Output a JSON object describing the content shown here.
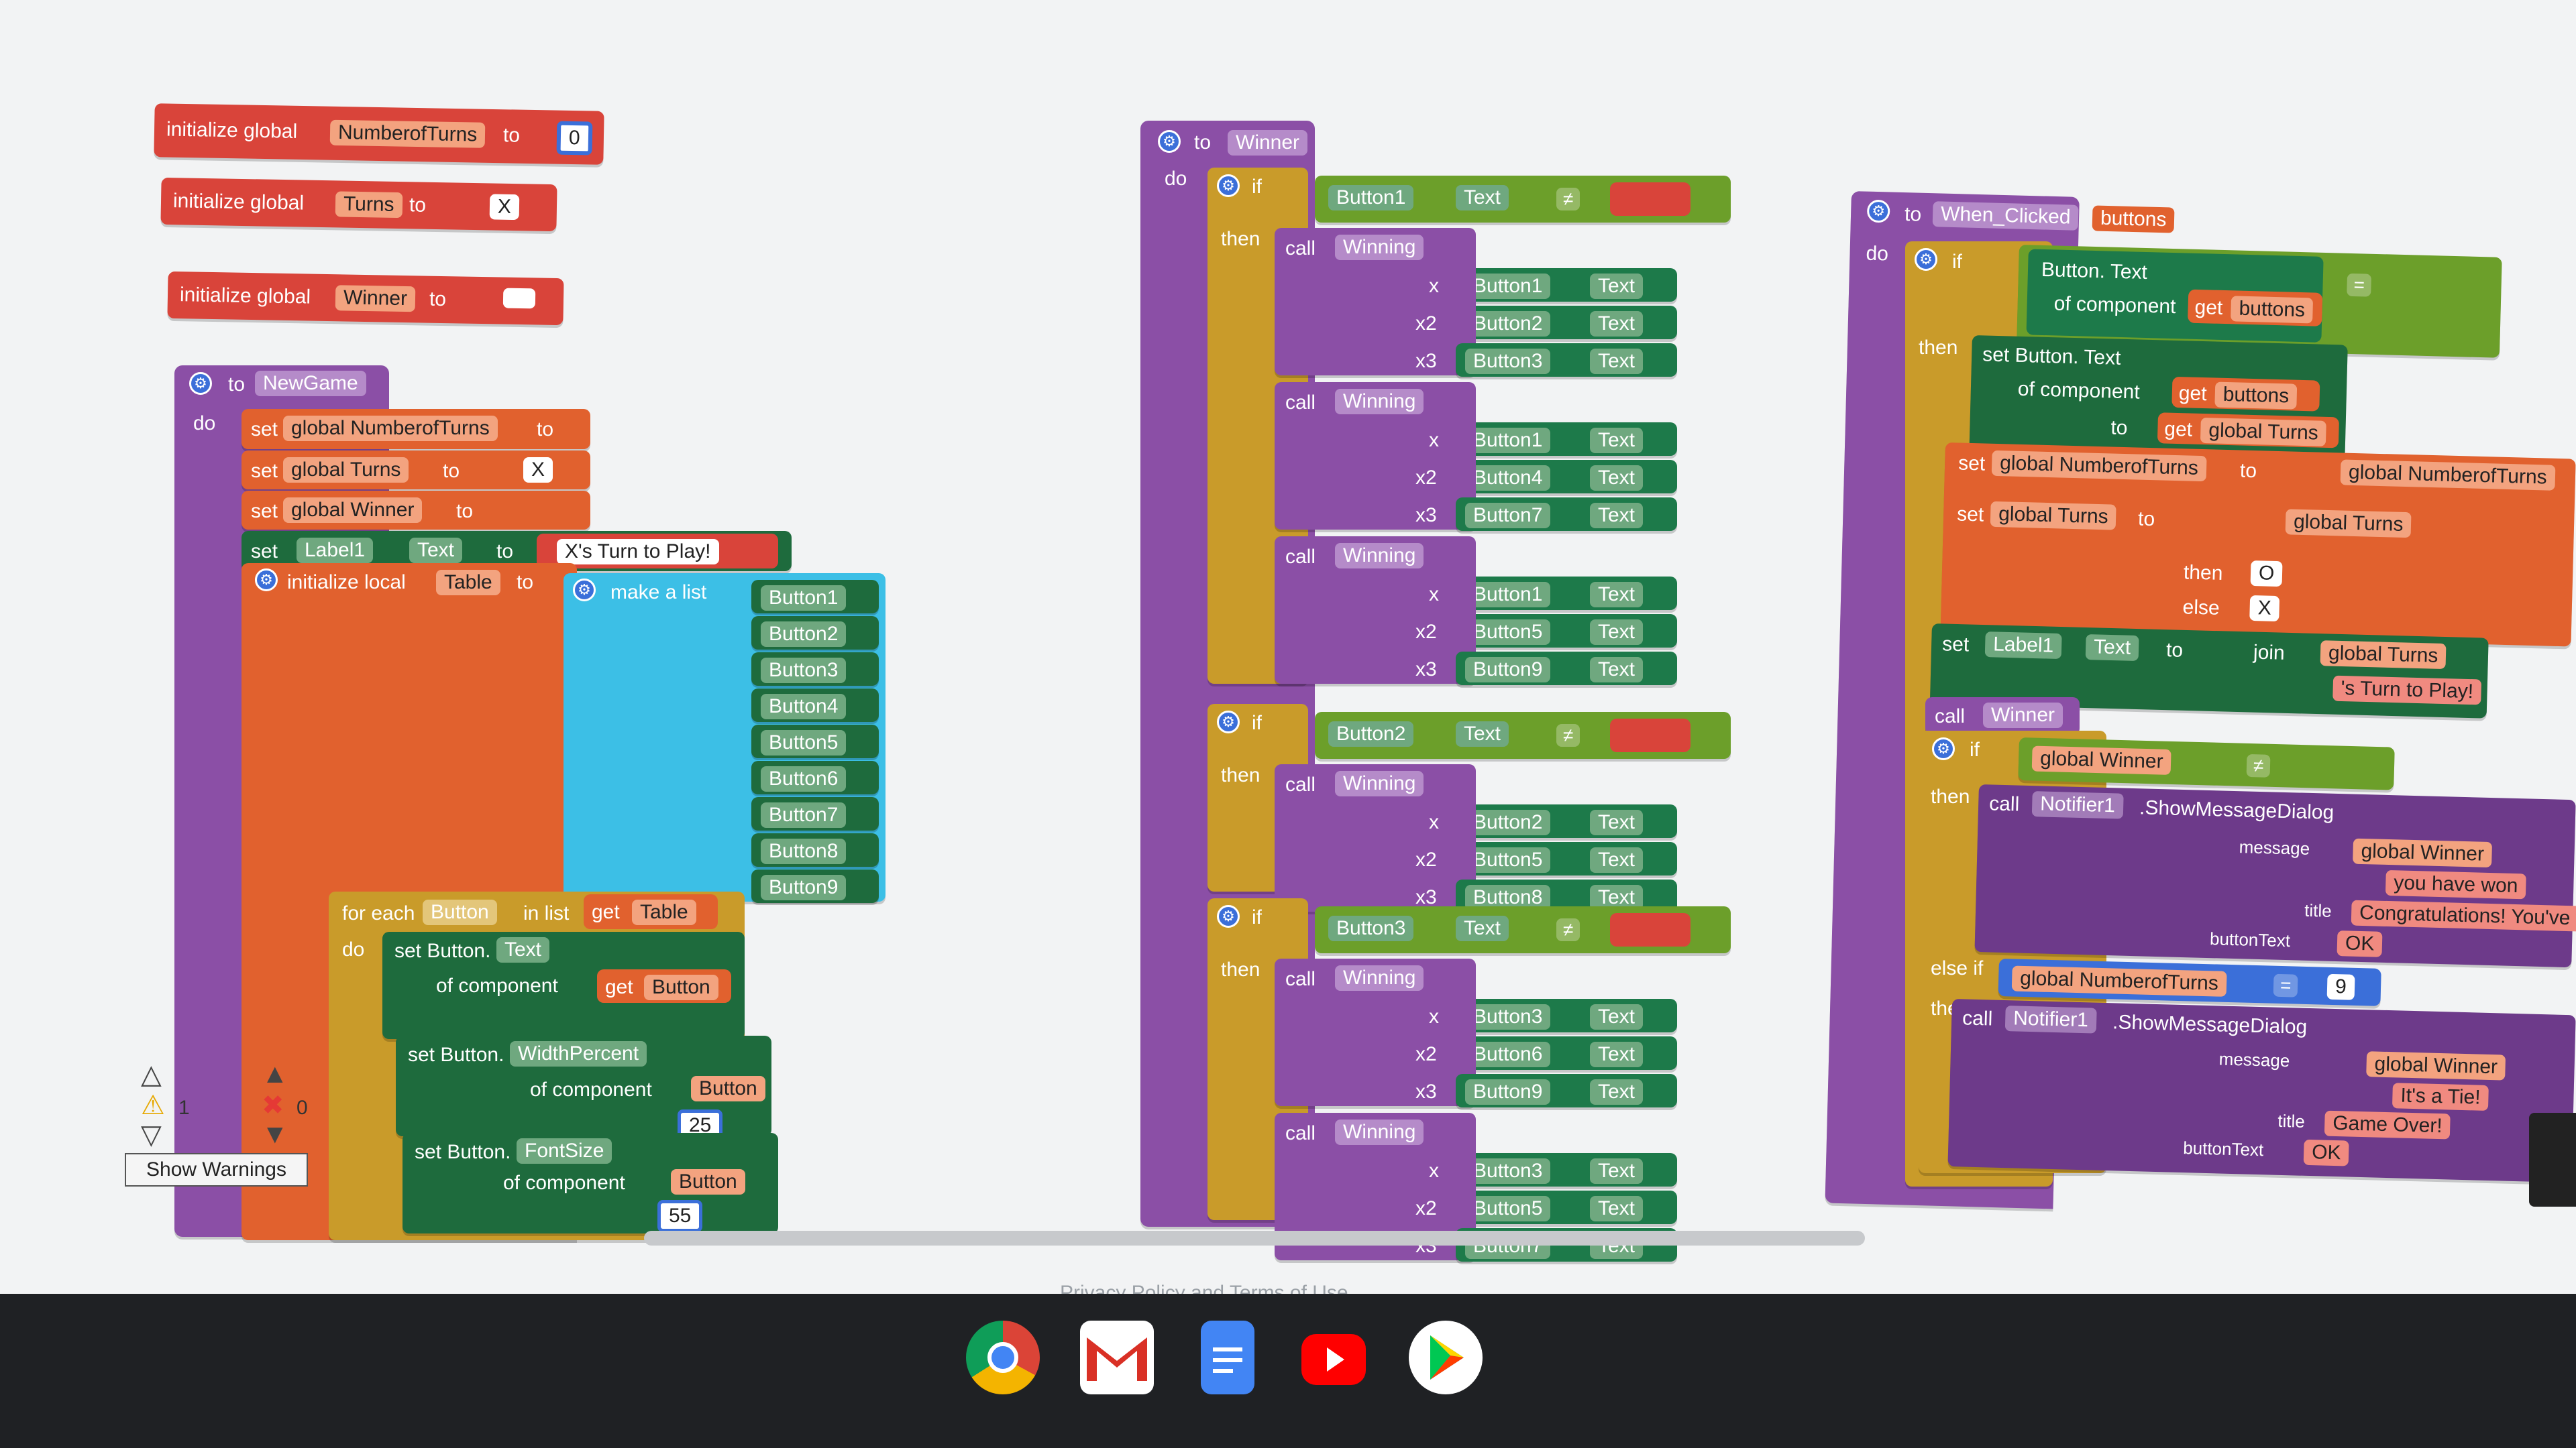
{
  "globals": {
    "numberofturns": {
      "kw": "initialize global",
      "name": "NumberofTurns",
      "to": "to",
      "value": "0"
    },
    "turns": {
      "kw": "initialize global",
      "name": "Turns",
      "to": "to",
      "value": "X"
    },
    "winner": {
      "kw": "initialize global",
      "name": "Winner",
      "to": "to",
      "value": ""
    }
  },
  "newgame": {
    "to": "to",
    "name": "NewGame",
    "do": "do",
    "set": "set",
    "to_kw": "to",
    "set1": "global NumberofTurns",
    "set2": "global Turns",
    "set2_val": "X",
    "set3": "global Winner",
    "set4_comp": "Label1",
    "set4_prop": "Text",
    "set4_val": "X's Turn to Play!",
    "init_local": "initialize local",
    "local_name": "Table",
    "make_list": "make a list",
    "buttons": [
      "Button1",
      "Button2",
      "Button3",
      "Button4",
      "Button5",
      "Button6",
      "Button7",
      "Button8",
      "Button9"
    ],
    "foreach": "for each",
    "item": "Button",
    "in_list": "in list",
    "get": "get",
    "get_table": "Table",
    "do_kw": "do",
    "set_button": "set Button.",
    "prop_text": "Text",
    "of_component": "of component",
    "get_button": "Button",
    "prop_width": "WidthPercent",
    "width_val": "25",
    "prop_font": "FontSize",
    "font_val": "55"
  },
  "winner_proc": {
    "to": "to",
    "name": "Winner",
    "do": "do",
    "if": "if",
    "then": "then",
    "call": "call",
    "proc": "Winning",
    "text": "Text",
    "neq": "≠",
    "x": "x",
    "x2": "x2",
    "x3": "x3",
    "if1_btn": "Button1",
    "if2_btn": "Button2",
    "if3_btn": "Button3",
    "c1": [
      [
        "Button1",
        "Button2",
        "Button3"
      ],
      [
        "Button1",
        "Button4",
        "Button7"
      ],
      [
        "Button1",
        "Button5",
        "Button9"
      ]
    ],
    "c2": [
      [
        "Button2",
        "Button5",
        "Button8"
      ]
    ],
    "c3": [
      [
        "Button3",
        "Button6",
        "Button9"
      ],
      [
        "Button3",
        "Button5",
        "Button7"
      ]
    ]
  },
  "when_clicked": {
    "to": "to",
    "name": "When_Clicked",
    "param": "buttons",
    "do": "do",
    "if": "if",
    "then": "then",
    "button_text": "Button. Text",
    "of_component": "of component",
    "get": "get",
    "get_buttons": "buttons",
    "eq": "=",
    "set_button_text": "set Button. Text",
    "to_kw": "to",
    "global_turns": "global Turns",
    "set": "set",
    "global_nturns": "global NumberofTurns",
    "global_nturns_get": "global NumberofTurns",
    "then_o": "O",
    "else": "else",
    "else_x": "X",
    "label1": "Label1",
    "text": "Text",
    "join": "join",
    "turn_msg": "'s Turn to Play!",
    "call": "call",
    "winner": "Winner",
    "global_winner": "global Winner",
    "neq": "≠",
    "notifier": "Notifier1",
    "show_msg": ".ShowMessageDialog",
    "message": "message",
    "msg1_part": "global Winner",
    "msg1_tail": "you have won",
    "title": "title",
    "title1": "Congratulations! You've won",
    "button_text_kw": "buttonText",
    "ok": "OK",
    "else_if": "else if",
    "nturns_eq": "9",
    "msg2_part": "global Winner",
    "msg2_tail": "It's a Tie!",
    "title2": "Game Over!"
  },
  "warnings": {
    "count_warn": "1",
    "count_err": "0",
    "show": "Show Warnings"
  },
  "footer": "Privacy Policy and Terms of Use",
  "taskbar": [
    "chrome-icon",
    "gmail-icon",
    "docs-icon",
    "youtube-icon",
    "play-store-icon"
  ]
}
